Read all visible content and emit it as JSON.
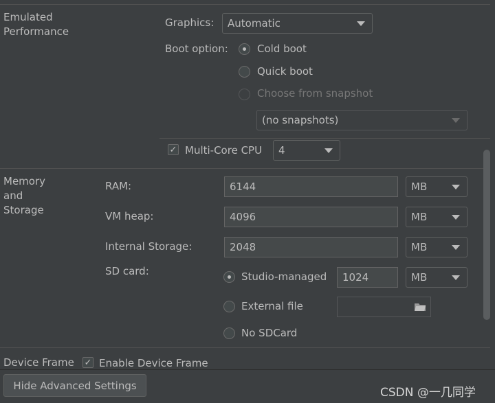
{
  "emulated_performance": {
    "section_title": "Emulated\nPerformance",
    "graphics_label": "Graphics:",
    "graphics_value": "Automatic",
    "boot_option_label": "Boot option:",
    "boot_options": [
      "Cold boot",
      "Quick boot",
      "Choose from snapshot"
    ],
    "snapshot_value": "(no snapshots)",
    "multicore_label": "Multi-Core CPU",
    "multicore_checked": true,
    "cores_value": "4"
  },
  "memory_storage": {
    "section_title": "Memory\nand\nStorage",
    "ram_label": "RAM:",
    "ram_value": "6144",
    "ram_unit": "MB",
    "vmheap_label": "VM heap:",
    "vmheap_value": "4096",
    "vmheap_unit": "MB",
    "internal_label": "Internal Storage:",
    "internal_value": "2048",
    "internal_unit": "MB",
    "sdcard_label": "SD card:",
    "sd_options": [
      "Studio-managed",
      "External file",
      "No SDCard"
    ],
    "sd_value": "1024",
    "sd_unit": "MB"
  },
  "device_frame": {
    "section_title": "Device Frame",
    "enable_label": "Enable Device Frame",
    "enabled": true
  },
  "buttons": {
    "hide_advanced": "Hide Advanced Settings"
  },
  "watermark": "CSDN @一几同学",
  "icons": {
    "dropdown": "chevron-down-icon",
    "folder": "folder-icon",
    "check": "checkmark-icon"
  },
  "colors": {
    "background": "#3c3f41",
    "text": "#bbbbbb",
    "field": "#45494a",
    "separator": "#515151"
  }
}
